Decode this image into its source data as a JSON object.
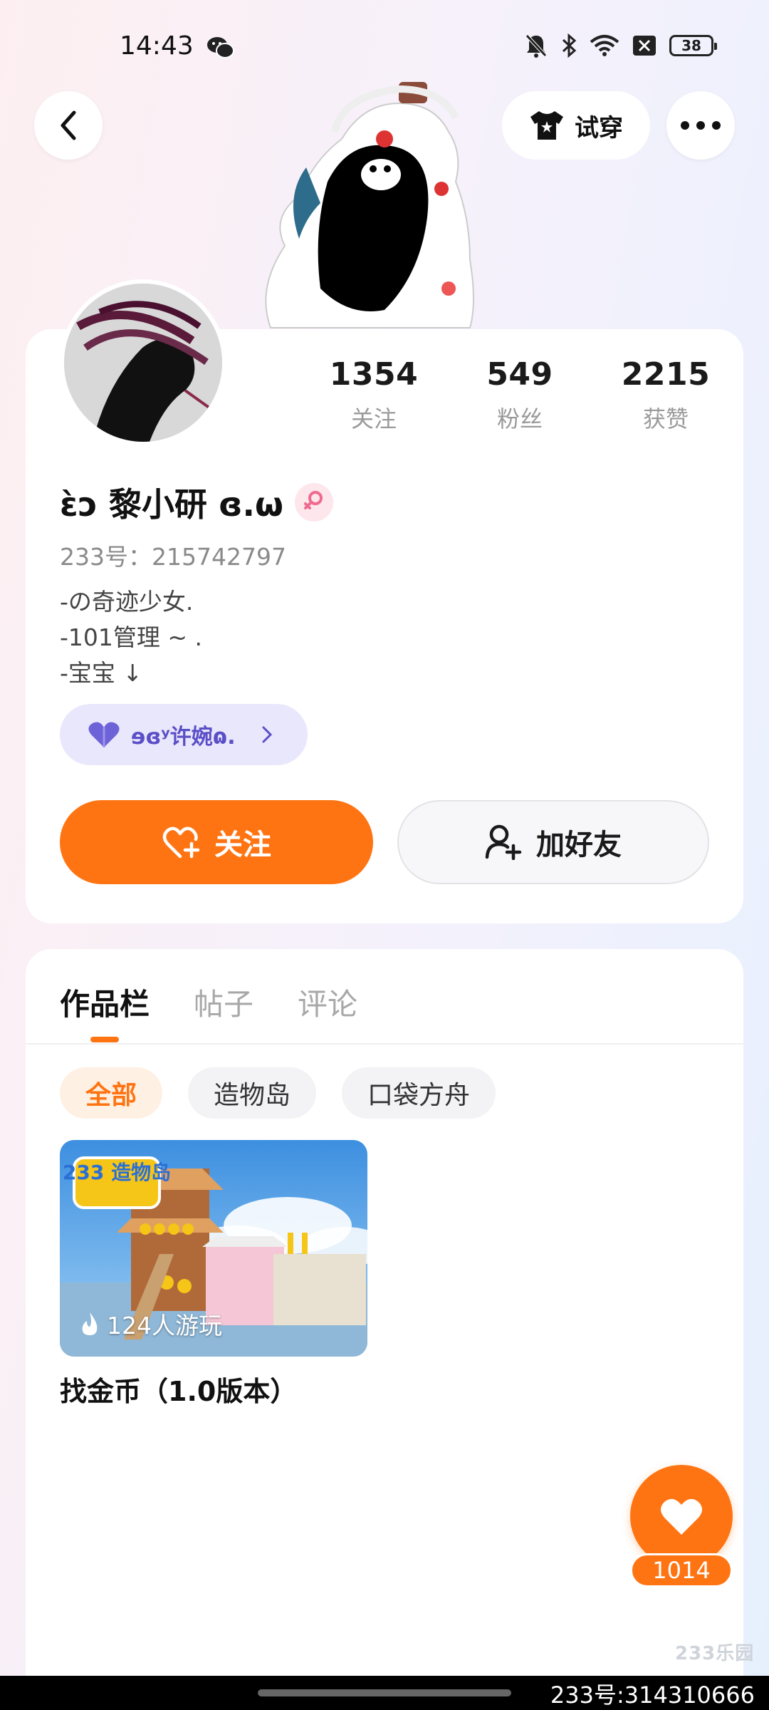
{
  "status_bar": {
    "time": "14:43",
    "battery": "38"
  },
  "header": {
    "try_on_label": "试穿"
  },
  "profile": {
    "stats": [
      {
        "value": "1354",
        "label": "关注"
      },
      {
        "value": "549",
        "label": "粉丝"
      },
      {
        "value": "2215",
        "label": "获赞"
      }
    ],
    "name": "ɛ̀ɔ 黎小研 ɞ.ω",
    "uid": "233号：215742797",
    "bio": "-の奇迹少女.\n-101管理 ~ .\n-宝宝 ↓",
    "couple_label": "ɘɞʸ许婉ɷ.",
    "follow_label": "关注",
    "add_friend_label": "加好友",
    "accent_color": "#ff7412"
  },
  "content": {
    "tabs": [
      "作品栏",
      "帖子",
      "评论"
    ],
    "active_tab": 0,
    "chips": [
      "全部",
      "造物岛",
      "口袋方舟"
    ],
    "active_chip": 0,
    "works": [
      {
        "title": "找金币（1.0版本）",
        "plays": "124人游玩",
        "badge": "233 造物岛"
      }
    ]
  },
  "like_count": "1014",
  "watermark": {
    "logo": "233乐园",
    "id": "233号:314310666"
  }
}
